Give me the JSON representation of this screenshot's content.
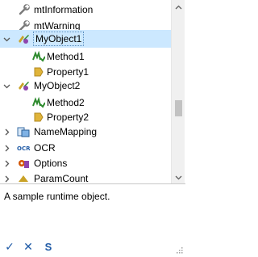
{
  "tree": {
    "items": [
      {
        "label": "mtInformation",
        "icon": "wrench-icon"
      },
      {
        "label": "mtWarning",
        "icon": "wrench-icon"
      },
      {
        "label": "MyObject1",
        "icon": "object-icon",
        "expanded": true,
        "selected": true
      },
      {
        "label": "Method1",
        "icon": "method-icon"
      },
      {
        "label": "Property1",
        "icon": "property-icon"
      },
      {
        "label": "MyObject2",
        "icon": "object-icon",
        "expanded": true
      },
      {
        "label": "Method2",
        "icon": "method-icon"
      },
      {
        "label": "Property2",
        "icon": "property-icon"
      },
      {
        "label": "NameMapping",
        "icon": "namemapping-icon",
        "expanded": false
      },
      {
        "label": "OCR",
        "icon": "ocr-icon",
        "expanded": false
      },
      {
        "label": "Options",
        "icon": "options-icon",
        "expanded": false
      },
      {
        "label": "ParamCount",
        "icon": "paramcount-icon",
        "expanded": false
      }
    ]
  },
  "description": "A sample runtime object.",
  "actions": {
    "ok": "✓",
    "cancel": "✕",
    "s": "S"
  },
  "colors": {
    "selection": "#cce8ff",
    "accent": "#1f5aa6",
    "method": "#2e8b2e",
    "property": "#d4a017"
  }
}
